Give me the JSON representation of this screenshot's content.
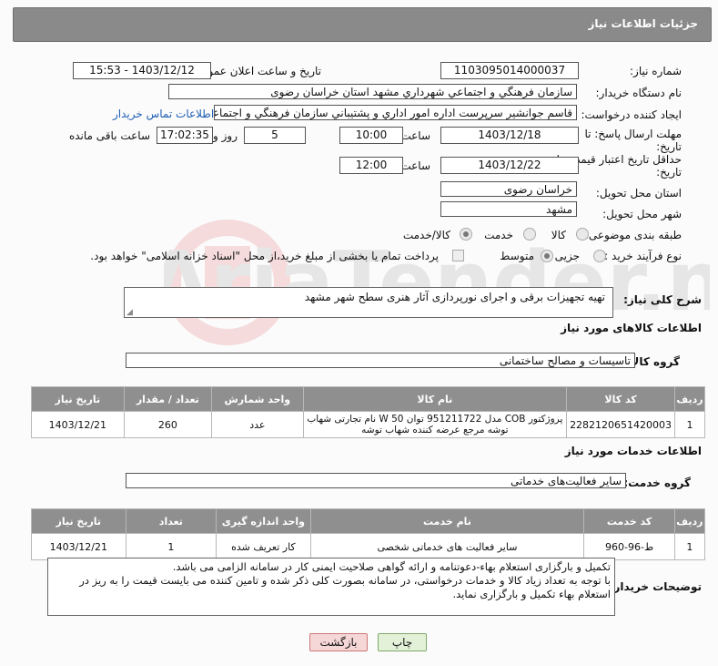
{
  "header": {
    "title": "جزئیات اطلاعات نیاز"
  },
  "fields": {
    "need_number_label": "شماره نیاز:",
    "need_number": "1103095014000037",
    "announce_label": "تاریخ و ساعت اعلان عمومی:",
    "announce_value": "1403/12/12 - 15:53",
    "buyer_org_label": "نام دستگاه خریدار:",
    "buyer_org": "سازمان فرهنگي و اجتماعي شهرداري مشهد استان خراسان رضوی",
    "creator_label": "ایجاد کننده درخواست:",
    "creator": "قاسم جوانشير سرپرست اداره امور اداري و پشتيباني سازمان فرهنگي و اجتماعي",
    "contact_link": "اطلاعات تماس خریدار",
    "deadline_label_1": "مهلت ارسال پاسخ: تا",
    "deadline_label_2": "تاریخ:",
    "deadline_date": "1403/12/18",
    "time_label": "ساعت",
    "deadline_time": "10:00",
    "days_value": "5",
    "days_label": "روز و",
    "remaining_time": "17:02:35",
    "remaining_label": "ساعت باقی مانده",
    "validity_label_1": "حداقل تاریخ اعتبار قیمت: تا",
    "validity_label_2": "تاریخ:",
    "validity_date": "1403/12/22",
    "validity_time": "12:00",
    "province_label": "استان محل تحویل:",
    "province": "خراسان رضوی",
    "city_label": "شهر محل تحویل:",
    "city": "مشهد",
    "category_label": "طبقه بندی موضوعی:",
    "category_options": [
      "کالا",
      "خدمت",
      "کالا/خدمت"
    ],
    "process_label": "نوع فرآیند خرید :",
    "process_options": [
      "جزیی",
      "متوسط"
    ],
    "payment_note": "پرداخت تمام یا بخشی از مبلغ خرید،از محل \"اسناد خزانه اسلامی\" خواهد بود.",
    "description_label": "شرح کلی نیاز:",
    "description": "تهیه تجهیزات برقی و اجرای نورپردازی آثار هنری سطح شهر مشهد"
  },
  "goods": {
    "section_title": "اطلاعات کالاهای مورد نیاز",
    "group_label": "گروه کالا:",
    "group_value": "تاسیسات و مصالح ساختمانی",
    "headers": [
      "ردیف",
      "کد کالا",
      "نام کالا",
      "واحد شمارش",
      "تعداد / مقدار",
      "تاریخ نیاز"
    ],
    "rows": [
      {
        "row": "1",
        "code": "2282120651420003",
        "name": "پروژکتور COB مدل 951211722 توان W 50 نام تجارتی شهاب توشه مرجع عرضه کننده شهاب توشه",
        "unit": "عدد",
        "qty": "260",
        "date": "1403/12/21"
      }
    ]
  },
  "services": {
    "section_title": "اطلاعات خدمات مورد نیاز",
    "group_label": "گروه خدمت:",
    "group_value": "سایر فعالیت‌های خدماتی",
    "headers": [
      "ردیف",
      "کد خدمت",
      "نام خدمت",
      "واحد اندازه گیری",
      "تعداد",
      "تاریخ نیاز"
    ],
    "rows": [
      {
        "row": "1",
        "code": "ط-96-960",
        "name": "سایر فعالیت های خدماتی شخصی",
        "unit": "کار تعریف شده",
        "qty": "1",
        "date": "1403/12/21"
      }
    ]
  },
  "buyer_notes": {
    "label": "توضیحات خریدار:",
    "line1": "تکمیل و بارگزاری استعلام بهاء-دعوتنامه و ارائه گواهی صلاحیت ایمنی کار در سامانه الزامی می باشد.",
    "line2": "با توجه به تعداد زیاد کالا و خدمات درخواستی، در سامانه بصورت کلی ذکر شده و تامین کننده می بایست قیمت را به ریز در",
    "line3": "استعلام بهاء تکمیل و بارگزاری نماید."
  },
  "buttons": {
    "print": "چاپ",
    "back": "بازگشت"
  },
  "colors": {
    "header_bg": "#8a8a8a",
    "link": "#1f5fb3",
    "print_btn": "#e3f1d9",
    "back_btn": "#f6d7d7"
  }
}
